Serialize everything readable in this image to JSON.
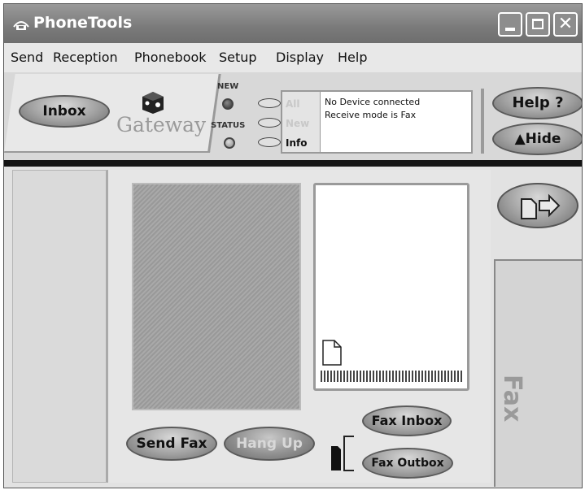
{
  "window": {
    "title": "PhoneTools"
  },
  "menu": [
    "Send",
    "Reception",
    "Phonebook",
    "Setup",
    "Display",
    "Help"
  ],
  "toolbar": {
    "inbox_label": "Inbox",
    "brand": "Gateway",
    "new_label": "NEW",
    "status_label": "STATUS",
    "filters": [
      "All",
      "New",
      "Info"
    ],
    "status_lines": [
      "No Device connected",
      "Receive mode is Fax"
    ],
    "help_label": "Help ?",
    "hide_label": "▲Hide"
  },
  "fax": {
    "send_label": "Send Fax",
    "hangup_label": "Hang Up",
    "inbox_label": "Fax Inbox",
    "outbox_label": "Fax Outbox",
    "tab_label": "Fax"
  }
}
